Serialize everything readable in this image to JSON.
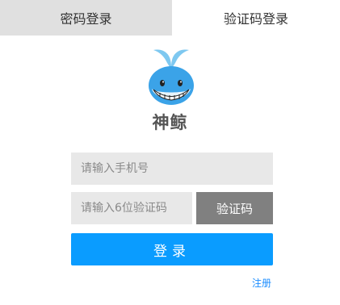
{
  "tabs": {
    "password_login": "密码登录",
    "code_login": "验证码登录",
    "active": "code_login"
  },
  "brand": {
    "name": "神鲸",
    "logo_icon": "whale-logo-icon"
  },
  "form": {
    "phone_placeholder": "请输入手机号",
    "phone_value": "",
    "code_placeholder": "请输入6位验证码",
    "code_value": "",
    "get_code_label": "验证码",
    "login_label": "登录",
    "register_label": "注册"
  },
  "colors": {
    "inactive_tab_bg": "#e0e0e0",
    "input_bg": "#e8e8e8",
    "code_button_bg": "#808080",
    "login_button_bg": "#0a9cff",
    "link_color": "#1a8cff"
  }
}
